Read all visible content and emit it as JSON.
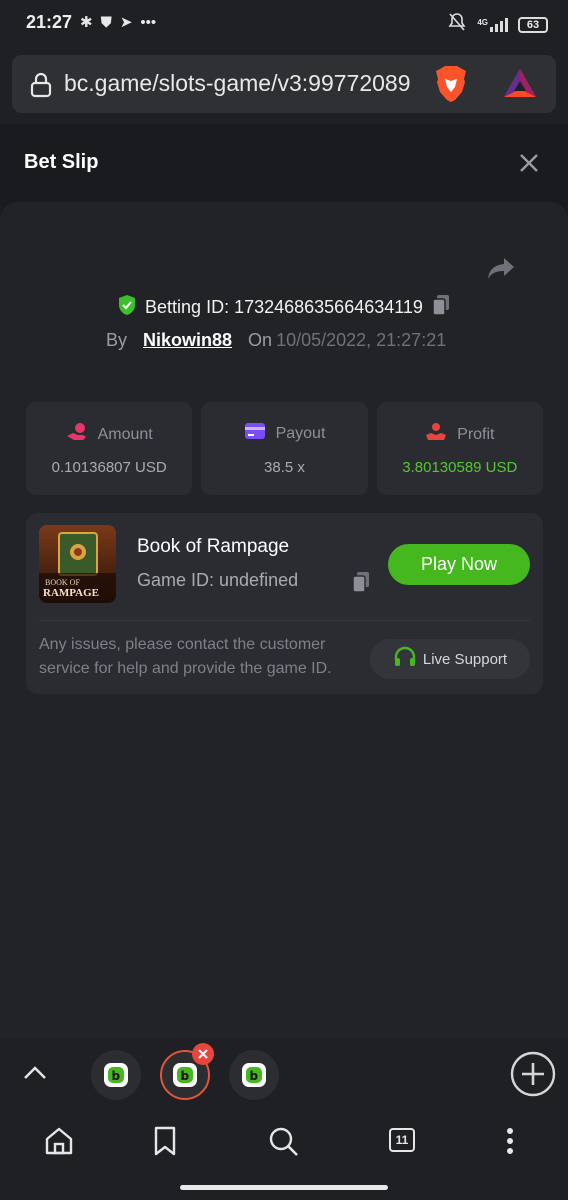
{
  "status_bar": {
    "time": "21:27",
    "network": "4G",
    "battery": "63"
  },
  "browser": {
    "url": "bc.game/slots-game/v3:99772089",
    "tab_count": "11"
  },
  "bet_slip": {
    "title": "Bet Slip",
    "betting_id_label": "Betting ID: 1732468635664634119",
    "by_label": "By",
    "username": "Nikowin88",
    "on_label": "On",
    "datetime": "10/05/2022, 21:27:21",
    "stats": [
      {
        "label": "Amount",
        "value": "0.10136807 USD",
        "icon": "coins-hand-icon",
        "color": "#e8356b"
      },
      {
        "label": "Payout",
        "value": "38.5 x",
        "icon": "card-icon",
        "color": "#7b4dfa"
      },
      {
        "label": "Profit",
        "value": "3.80130589 USD",
        "icon": "profit-hand-icon",
        "color": "#e8453c"
      }
    ],
    "game": {
      "name": "Book of Rampage",
      "game_id": "Game ID: undefined",
      "thumb_title_1": "BOOK OF",
      "thumb_title_2": "RAMPAGE",
      "play_label": "Play Now",
      "notice": "Any issues, please contact the customer service for help and provide the game ID.",
      "support_label": "Live Support"
    }
  },
  "colors": {
    "accent_green": "#46b81f",
    "profit_green": "#55c633",
    "background": "#1a1b1f",
    "panel": "#222327",
    "card": "#2b2c31"
  }
}
